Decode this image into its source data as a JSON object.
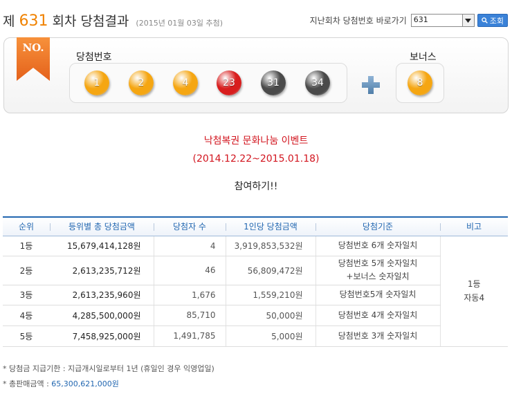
{
  "header": {
    "prefix": "제",
    "draw_number": "631",
    "suffix": "회차 당첨결과",
    "draw_date": "(2015년 01월 03일 추첨)"
  },
  "nav": {
    "label": "지난회차 당첨번호 바로가기",
    "selected_draw": "631",
    "search_button": "조회"
  },
  "winning": {
    "ribbon_text": "NO.",
    "numbers_label": "당첨번호",
    "bonus_label": "보너스",
    "numbers": [
      {
        "value": "1",
        "color": "#f5a612"
      },
      {
        "value": "2",
        "color": "#f5a612"
      },
      {
        "value": "4",
        "color": "#f5a612"
      },
      {
        "value": "23",
        "color": "#d81d1d"
      },
      {
        "value": "31",
        "color": "#4a4a4a"
      },
      {
        "value": "34",
        "color": "#4a4a4a"
      }
    ],
    "bonus": {
      "value": "8",
      "color": "#f5a612"
    }
  },
  "event": {
    "title": "낙첨복권 문화나눔 이벤트",
    "period": "(2014.12.22~2015.01.18)",
    "cta": "참여하기!!"
  },
  "table": {
    "headers": [
      "순위",
      "등위별 총 당첨금액",
      "당첨자 수",
      "1인당 당첨금액",
      "당첨기준",
      "비고"
    ],
    "rows": [
      {
        "rank": "1등",
        "total": "15,679,414,128원",
        "winners": "4",
        "per_person": "3,919,853,532원",
        "criteria": [
          "당첨번호 6개 숫자일치"
        ]
      },
      {
        "rank": "2등",
        "total": "2,613,235,712원",
        "winners": "46",
        "per_person": "56,809,472원",
        "criteria": [
          "당첨번호 5개 숫자일치",
          "+보너스 숫자일치"
        ]
      },
      {
        "rank": "3등",
        "total": "2,613,235,960원",
        "winners": "1,676",
        "per_person": "1,559,210원",
        "criteria": [
          "당첨번호5개 숫자일치"
        ]
      },
      {
        "rank": "4등",
        "total": "4,285,500,000원",
        "winners": "85,710",
        "per_person": "50,000원",
        "criteria": [
          "당첨번호 4개 숫자일치"
        ]
      },
      {
        "rank": "5등",
        "total": "7,458,925,000원",
        "winners": "1,491,785",
        "per_person": "5,000원",
        "criteria": [
          "당첨번호 3개 숫자일치"
        ]
      }
    ],
    "note": [
      "1등",
      "자동4"
    ]
  },
  "footer": {
    "deadline": "* 당첨금 지급기한 : 지급개시일로부터 1년 (휴일인 경우 익영업일)",
    "sales_label": "* 총판매금액 : ",
    "sales_amount": "65,300,621,000원"
  },
  "colors": {
    "accent_orange": "#f08200",
    "header_blue": "#2166b0",
    "event_red": "#d2141e"
  }
}
